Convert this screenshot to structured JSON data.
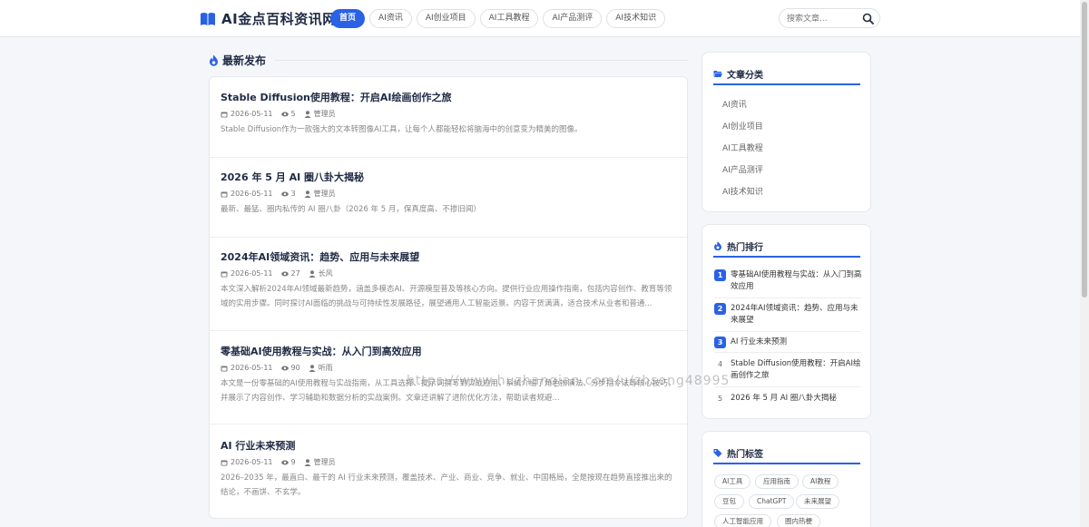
{
  "site": {
    "title": "AI金点百科资讯网"
  },
  "nav": {
    "items": [
      {
        "label": "首页",
        "active": true
      },
      {
        "label": "AI资讯",
        "active": false
      },
      {
        "label": "AI创业项目",
        "active": false
      },
      {
        "label": "AI工具教程",
        "active": false
      },
      {
        "label": "AI产品测评",
        "active": false
      },
      {
        "label": "AI技术知识",
        "active": false
      }
    ]
  },
  "search": {
    "placeholder": "搜索文章..."
  },
  "main": {
    "section_title": "最新发布",
    "articles": [
      {
        "title": "Stable Diffusion使用教程：开启AI绘画创作之旅",
        "date": "2026-05-11",
        "views": "5",
        "author": "管理员",
        "excerpt": "Stable Diffusion作为一款强大的文本转图像AI工具，让每个人都能轻松将脑海中的创意变为精美的图像。"
      },
      {
        "title": "2026 年 5 月 AI 圈八卦大揭秘",
        "date": "2026-05-11",
        "views": "3",
        "author": "管理员",
        "excerpt": "最新、最猛、圈内私传的 AI 圈八卦（2026 年 5 月，保真度高、不掺旧闻）"
      },
      {
        "title": "2024年AI领域资讯：趋势、应用与未来展望",
        "date": "2026-05-11",
        "views": "27",
        "author": "长风",
        "excerpt": "本文深入解析2024年AI领域最新趋势，涵盖多模态AI、开源模型普及等核心方向。提供行业应用操作指南，包括内容创作、教育等领域的实用步骤。同时探讨AI面临的挑战与可持续性发展路径，展望通用人工智能远景。内容干货满满，适合技术从业者和普通..."
      },
      {
        "title": "零基础AI使用教程与实战：从入门到高效应用",
        "date": "2026-05-11",
        "views": "90",
        "author": "听雨",
        "excerpt": "本文是一份零基础的AI使用教程与实战指南，从工具选择、提示词撰写到实战应用，系统介绍了角色扮演法、分步指令法等核心技巧，并展示了内容创作、学习辅助和数据分析的实战案例。文章还讲解了进阶优化方法，帮助读者规避..."
      },
      {
        "title": "AI 行业未来预测",
        "date": "2026-05-11",
        "views": "9",
        "author": "管理员",
        "excerpt": "2026–2035 年，最直白、最干的 AI 行业未来预测，覆盖技术、产业、商业、竞争、就业、中国格局，全是按现在趋势直接推出来的结论，不画饼、不玄学。"
      }
    ]
  },
  "sidebar": {
    "categories": {
      "title": "文章分类",
      "items": [
        "AI资讯",
        "AI创业项目",
        "AI工具教程",
        "AI产品测评",
        "AI技术知识"
      ]
    },
    "ranking": {
      "title": "热门排行",
      "items": [
        {
          "rank": "1",
          "title": "零基础AI使用教程与实战：从入门到高效应用"
        },
        {
          "rank": "2",
          "title": "2024年AI领域资讯：趋势、应用与未来展望"
        },
        {
          "rank": "3",
          "title": "AI 行业未来预测"
        },
        {
          "rank": "4",
          "title": "Stable Diffusion使用教程：开启AI绘画创作之旅"
        },
        {
          "rank": "5",
          "title": "2026 年 5 月 AI 圈八卦大揭秘"
        }
      ]
    },
    "tags": {
      "title": "热门标签",
      "items": [
        "AI工具",
        "应用指南",
        "AI教程",
        "豆包",
        "ChatGPT",
        "未来展望",
        "人工智能应用",
        "圈内热梗"
      ]
    }
  },
  "watermark": "https://www.huzhanqian.com/u/zhsong48995",
  "colors": {
    "accent": "#2a62e6",
    "heading": "#1f2a44",
    "muted": "#888888"
  }
}
